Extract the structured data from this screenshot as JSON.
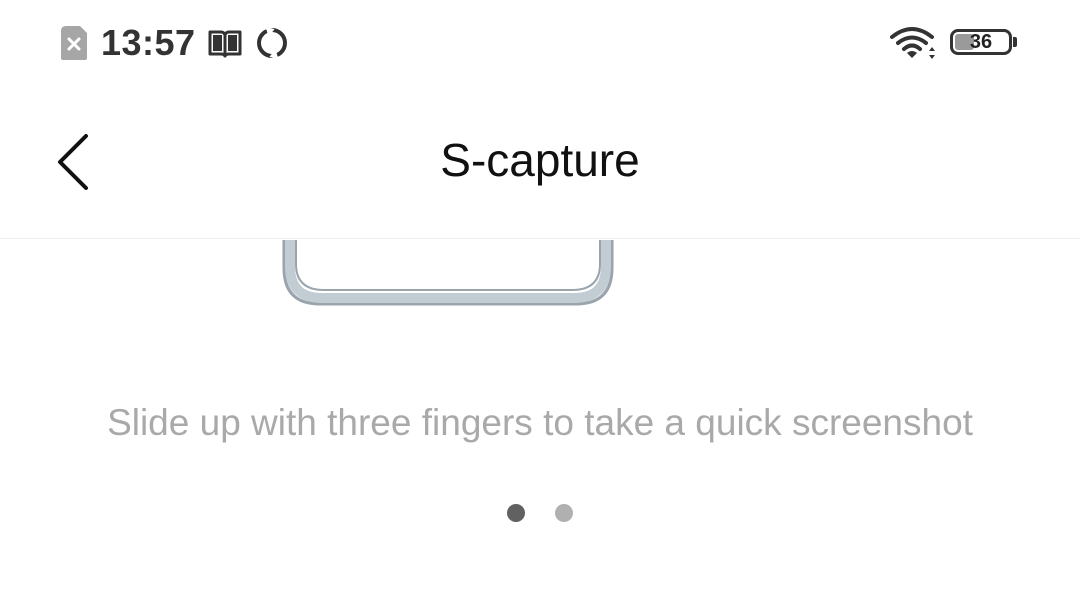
{
  "status_bar": {
    "time": "13:57",
    "battery_level": "36",
    "battery_fraction": 0.36,
    "icons": [
      "sim-no-signal-icon",
      "book-icon",
      "sync-icon",
      "wifi-icon",
      "battery-icon"
    ]
  },
  "header": {
    "title": "S-capture",
    "back_icon": "chevron-left-icon"
  },
  "content": {
    "illustration": "phone-frame-bottom-illustration",
    "caption": "Slide up with three fingers to take a quick screenshot"
  },
  "pager": {
    "count": 2,
    "current": 1
  },
  "colors": {
    "dot_active": "#616161",
    "dot_inactive": "#b0b0b0",
    "caption": "#a9a9a9",
    "phone_frame": "#c2ccd3"
  }
}
